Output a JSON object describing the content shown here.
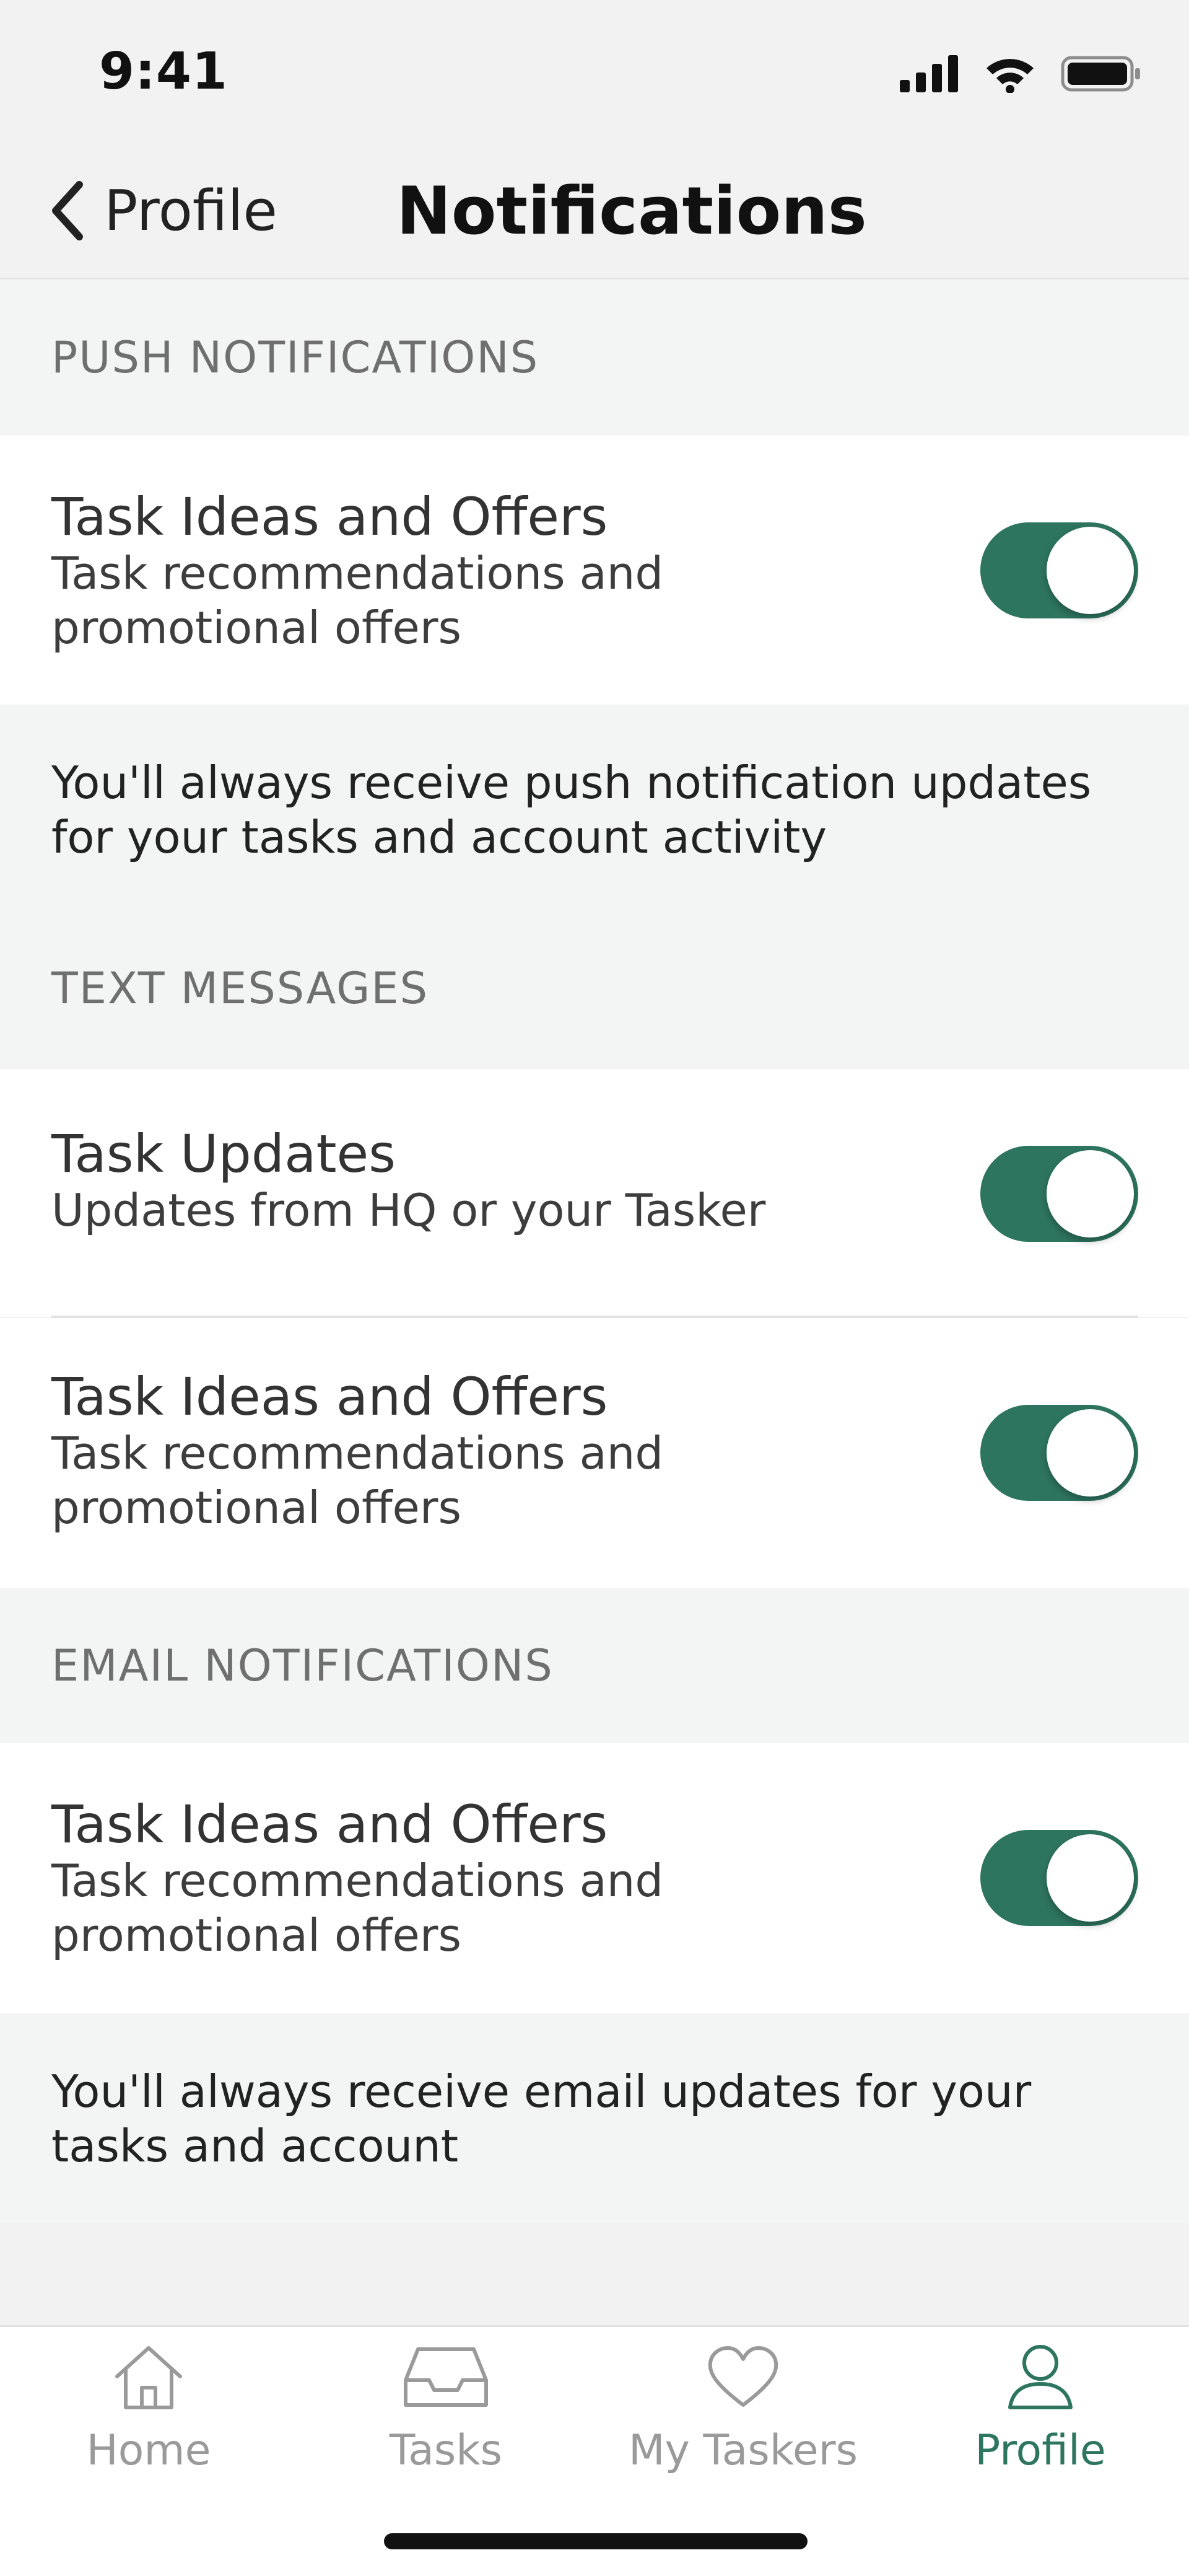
{
  "status_bar": {
    "time": "9:41"
  },
  "nav": {
    "back_label": "Profile",
    "title": "Notifications"
  },
  "push": {
    "header": "PUSH NOTIFICATIONS",
    "rows": [
      {
        "title": "Task Ideas and Offers",
        "subtitle": "Task recommendations and promotional offers",
        "enabled": true
      }
    ],
    "note": "You'll always receive push notification updates for your tasks and account activity"
  },
  "text": {
    "header": "TEXT MESSAGES",
    "rows": [
      {
        "title": "Task Updates",
        "subtitle": "Updates from HQ or your Tasker",
        "enabled": true
      },
      {
        "title": "Task Ideas and Offers",
        "subtitle": "Task recommendations and promotional offers",
        "enabled": true
      }
    ]
  },
  "email": {
    "header": "EMAIL NOTIFICATIONS",
    "rows": [
      {
        "title": "Task Ideas and Offers",
        "subtitle": "Task recommendations and promotional offers",
        "enabled": true
      }
    ],
    "note": "You'll always receive email updates for your tasks and account"
  },
  "tabbar": {
    "tabs": [
      {
        "label": "Home",
        "icon": "home-icon",
        "active": false
      },
      {
        "label": "Tasks",
        "icon": "inbox-icon",
        "active": false
      },
      {
        "label": "My Taskers",
        "icon": "heart-icon",
        "active": false
      },
      {
        "label": "Profile",
        "icon": "person-icon",
        "active": true
      }
    ]
  },
  "colors": {
    "accent": "#2e7560",
    "inactive_tab": "#9a9a9a",
    "section_bg": "#f3f5f4"
  }
}
